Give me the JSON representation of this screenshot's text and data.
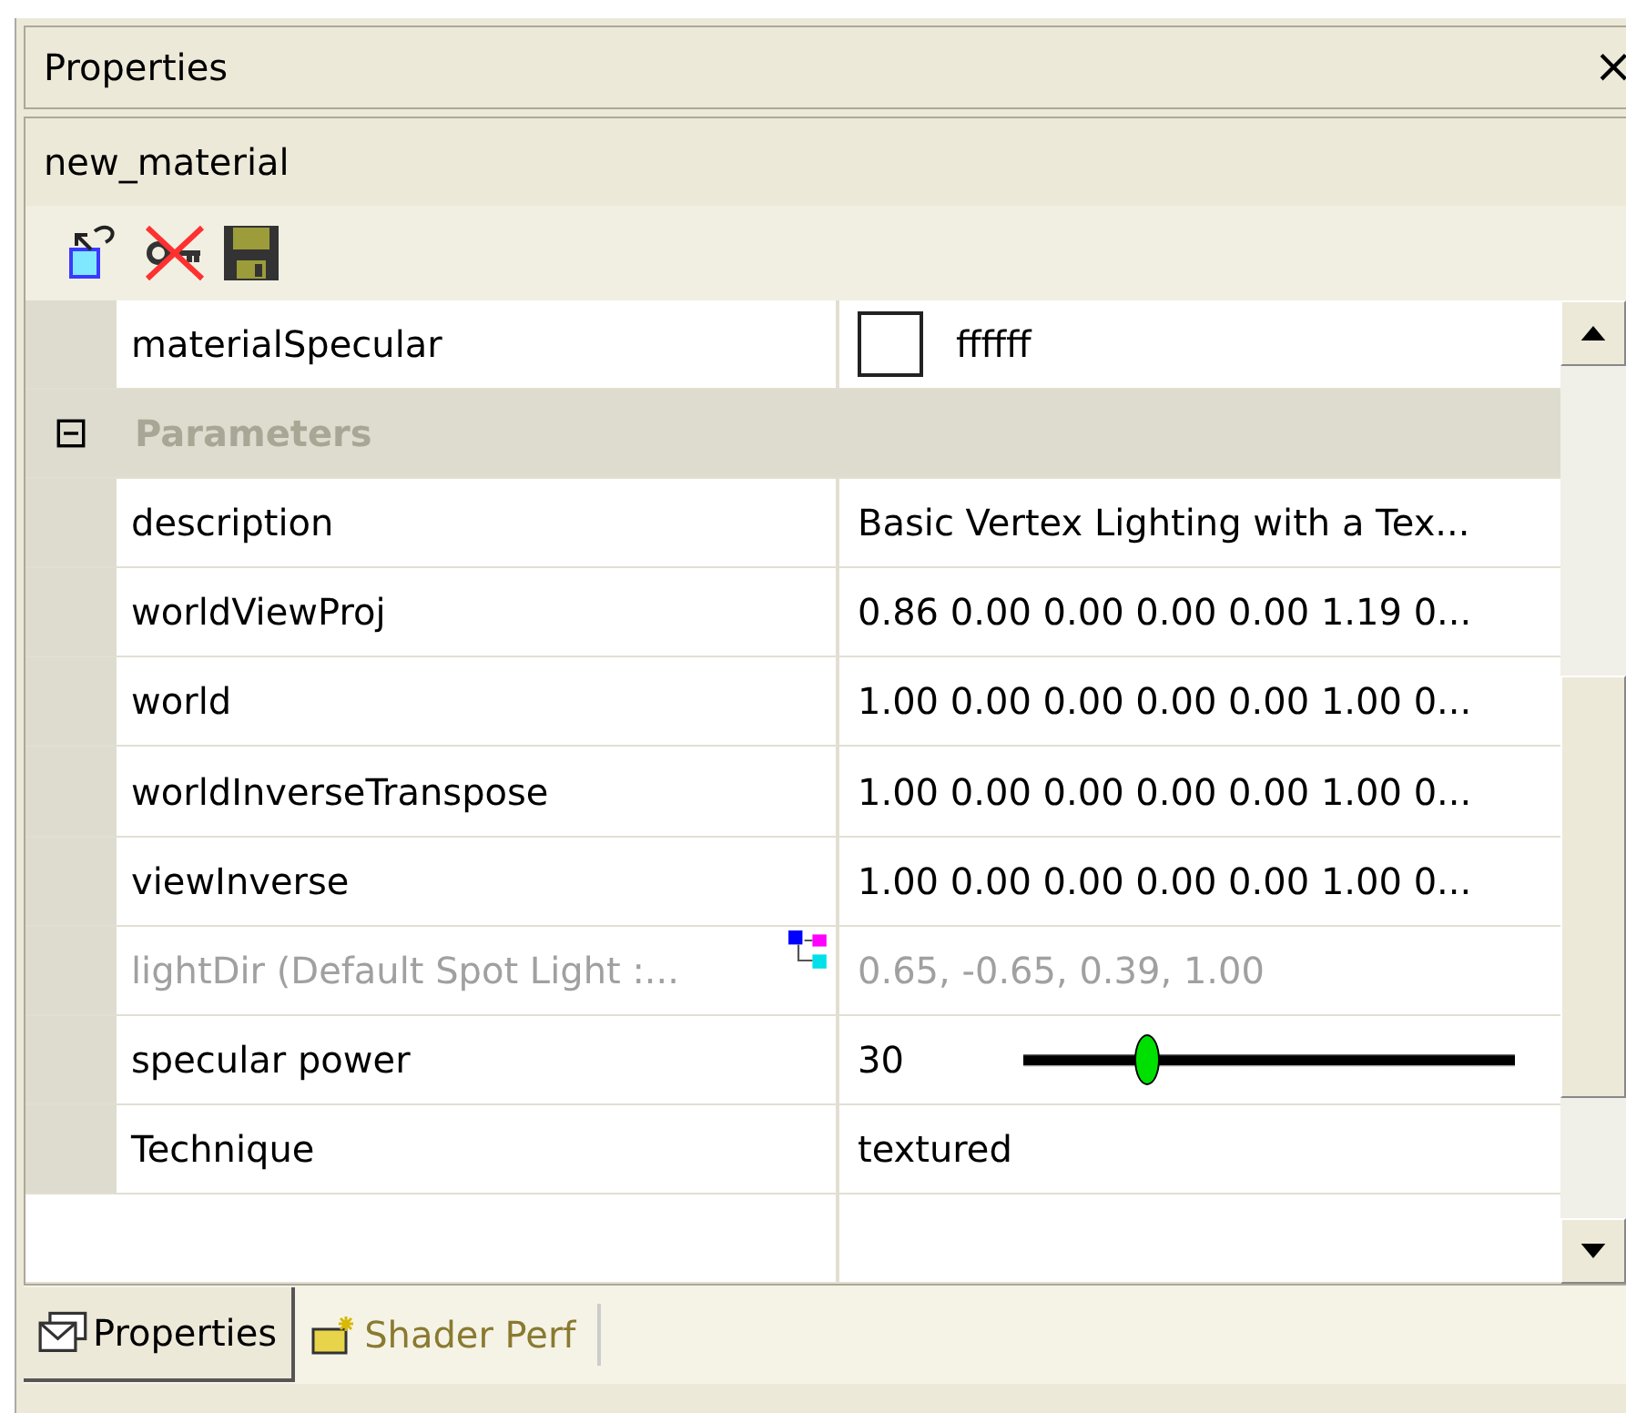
{
  "panel": {
    "title": "Properties",
    "close": "×"
  },
  "object_name": "new_material",
  "rows": [
    {
      "kind": "color",
      "name": "materialSpecular",
      "value": "ffffff",
      "color": "#ffffff"
    },
    {
      "kind": "category",
      "name": "Parameters",
      "expanded": true
    },
    {
      "kind": "text",
      "name": "description",
      "value": "Basic Vertex Lighting with a Tex...",
      "disabled": false
    },
    {
      "kind": "text",
      "name": "worldViewProj",
      "value": "0.86 0.00 0.00 0.00 0.00 1.19 0...",
      "disabled": false
    },
    {
      "kind": "text",
      "name": "world",
      "value": "1.00 0.00 0.00 0.00 0.00 1.00 0...",
      "disabled": false
    },
    {
      "kind": "text",
      "name": "worldInverseTranspose",
      "value": "1.00 0.00 0.00 0.00 0.00 1.00 0...",
      "disabled": false
    },
    {
      "kind": "text",
      "name": "viewInverse",
      "value": "1.00 0.00 0.00 0.00 0.00 1.00 0...",
      "disabled": false
    },
    {
      "kind": "link",
      "name": "lightDir (Default Spot Light :...",
      "value": "0.65, -0.65, 0.39, 1.00",
      "disabled": true
    },
    {
      "kind": "slider",
      "name": "specular power",
      "value": "30",
      "level": 0.25
    },
    {
      "kind": "text",
      "name": "Technique",
      "value": "textured",
      "disabled": false
    },
    {
      "kind": "empty"
    }
  ],
  "tabs": [
    {
      "label": "Properties",
      "selected": true
    },
    {
      "label": "Shader Perf",
      "selected": false
    }
  ]
}
